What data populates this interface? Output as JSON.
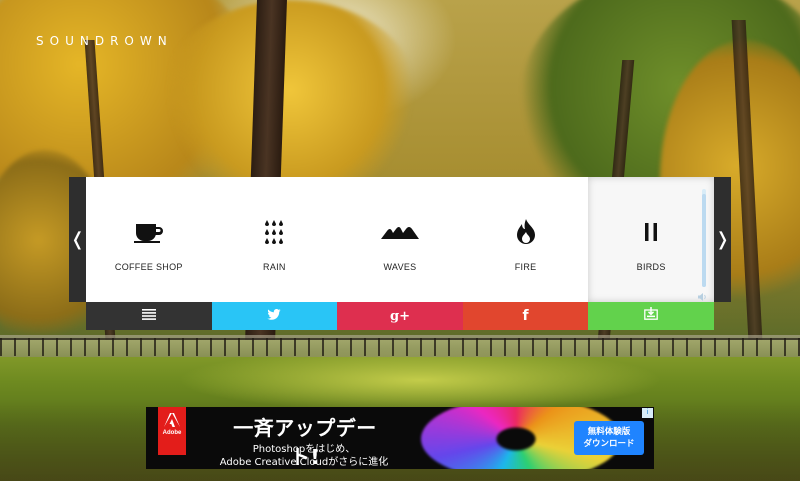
{
  "brand": {
    "logo_text": "SOUNDROWN"
  },
  "player": {
    "prev_arrow": "❬",
    "next_arrow": "❭",
    "sounds": [
      {
        "label": "COFFEE SHOP",
        "icon": "coffee-cup-icon",
        "active": false
      },
      {
        "label": "RAIN",
        "icon": "raindrops-icon",
        "active": false
      },
      {
        "label": "WAVES",
        "icon": "waves-icon",
        "active": false
      },
      {
        "label": "FIRE",
        "icon": "flame-icon",
        "active": false
      },
      {
        "label": "BIRDS",
        "icon": "pause-icon",
        "active": true
      }
    ],
    "volume_level": 0.95
  },
  "share": [
    {
      "name": "menu",
      "icon": "menu-icon",
      "color": "#333333"
    },
    {
      "name": "twitter",
      "icon": "twitter-icon",
      "color": "#29c5f6"
    },
    {
      "name": "google-plus",
      "icon": "google-plus-icon",
      "glyph": "g+",
      "color": "#de2f4f"
    },
    {
      "name": "facebook",
      "icon": "facebook-icon",
      "glyph": "f",
      "color": "#e1462e"
    },
    {
      "name": "download",
      "icon": "download-icon",
      "color": "#62d24c"
    }
  ],
  "ad": {
    "brand": "Adobe",
    "headline": "一斉アップデート!",
    "line1": "Photoshopをはじめ、",
    "line2": "Adobe Creative Cloudがさらに進化",
    "cta_line1": "無料体験版",
    "cta_line2": "ダウンロード",
    "info_glyph": "i"
  }
}
